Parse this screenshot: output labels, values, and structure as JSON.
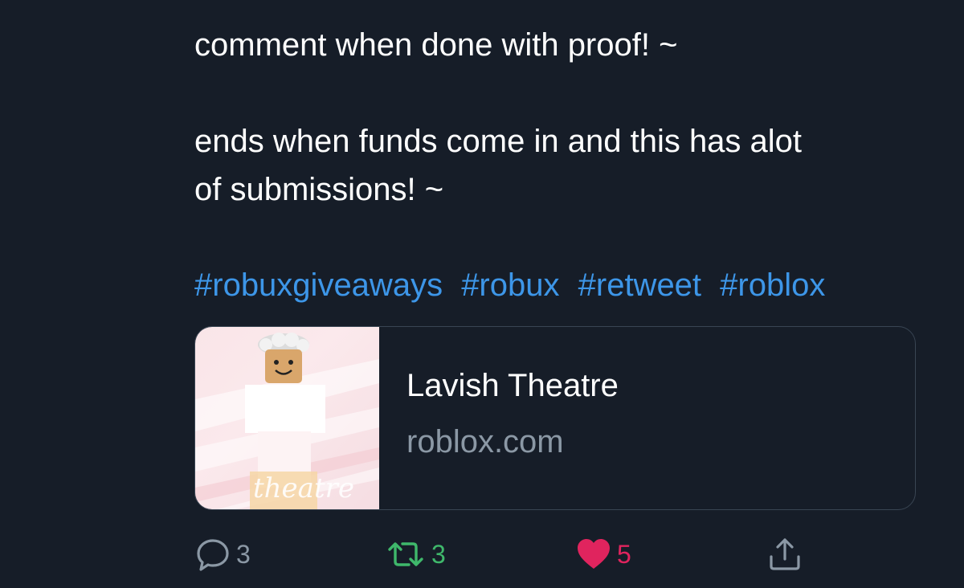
{
  "tweet": {
    "line1": "comment when done with proof! ~",
    "line2": "ends when funds come in and this has alot",
    "line3": "of submissions! ~",
    "hashtags": [
      "#robuxgiveaways",
      "#robux",
      "#retweet",
      "#roblox"
    ]
  },
  "card": {
    "title": "Lavish Theatre",
    "domain": "roblox.com",
    "thumbnail_text": "theatre"
  },
  "actions": {
    "reply_count": "3",
    "retweet_count": "3",
    "like_count": "5"
  },
  "colors": {
    "background": "#161d28",
    "text": "#ffffff",
    "hashtag": "#3d96e8",
    "muted": "#8b98a5",
    "retweet": "#3fb86b",
    "like": "#e0245e"
  },
  "icons": [
    "reply-icon",
    "retweet-icon",
    "heart-icon",
    "share-icon"
  ]
}
